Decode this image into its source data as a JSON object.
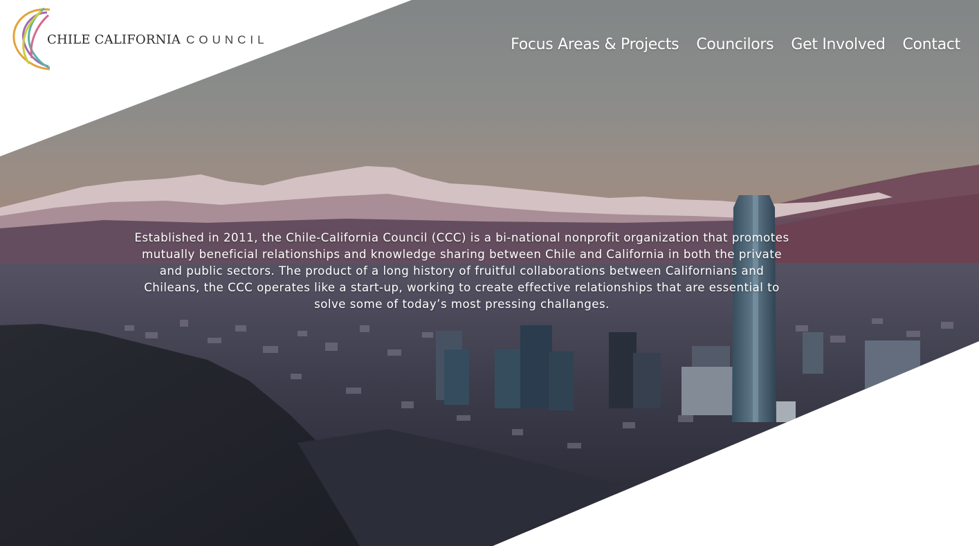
{
  "brand": {
    "name": "CHILE CALIFORNIA",
    "name_light": "COUNCIL",
    "logo_icon": "ccc-ribbon-logo-icon",
    "logo_colors": [
      "#e3a23b",
      "#9f6bb5",
      "#5bb1a8",
      "#c9cf3c",
      "#d36a8b"
    ]
  },
  "nav": {
    "items": [
      {
        "label": "Focus Areas & Projects"
      },
      {
        "label": "Councilors"
      },
      {
        "label": "Get Involved"
      },
      {
        "label": "Contact"
      }
    ]
  },
  "hero": {
    "image_description": "skyline-mountains-photo",
    "intro": "Established in 2011, the Chile-California Council (CCC) is a bi-national nonprofit organization that promotes mutually beneficial relationships and knowledge sharing between Chile and California in both the private and public sectors. The product of a long history of fruitful collaborations between Californians and Chileans, the CCC operates like a start-up, working to create effective relationships that are essential to solve some of today’s most pressing challanges."
  },
  "colors": {
    "nav_text": "#ffffff",
    "background": "#ffffff",
    "sky_top": "#8e9392",
    "sky_bottom": "#b0958c",
    "city_dark": "#2e2f3c"
  }
}
